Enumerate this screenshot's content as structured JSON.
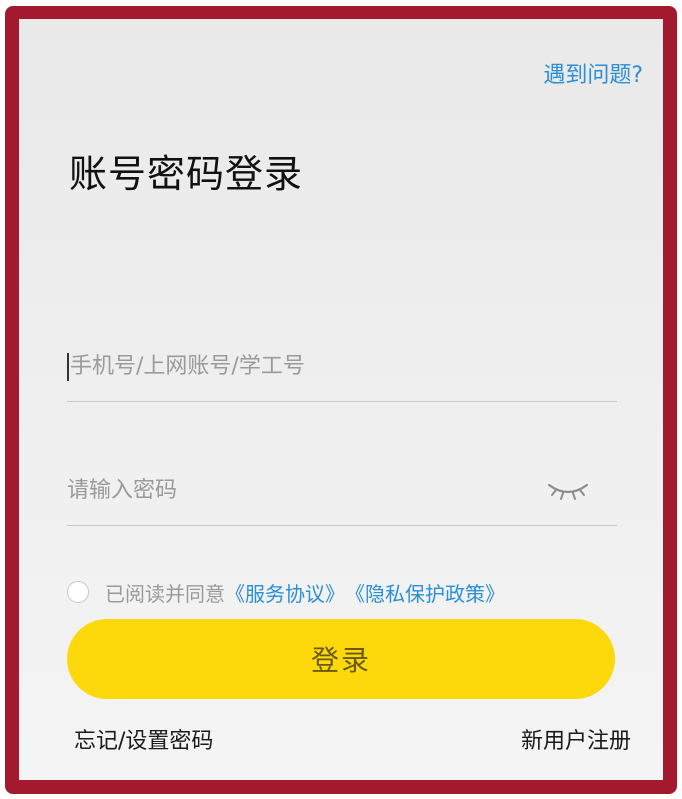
{
  "header": {
    "help_label": "遇到问题?",
    "title": "账号密码登录"
  },
  "form": {
    "account_placeholder": "手机号/上网账号/学工号",
    "account_value": "",
    "password_placeholder": "请输入密码",
    "password_value": "",
    "password_toggle_icon": "eye-closed-icon"
  },
  "agreement": {
    "checked": false,
    "prefix": "已阅读并同意",
    "service_link": "《服务协议》",
    "privacy_link": "《隐私保护政策》"
  },
  "login_button": "登录",
  "footer": {
    "forgot_label": "忘记/设置密码",
    "register_label": "新用户注册"
  },
  "colors": {
    "frame": "#a31a2e",
    "accent_yellow": "#fdd90b",
    "link_blue": "#2a8fd6"
  }
}
